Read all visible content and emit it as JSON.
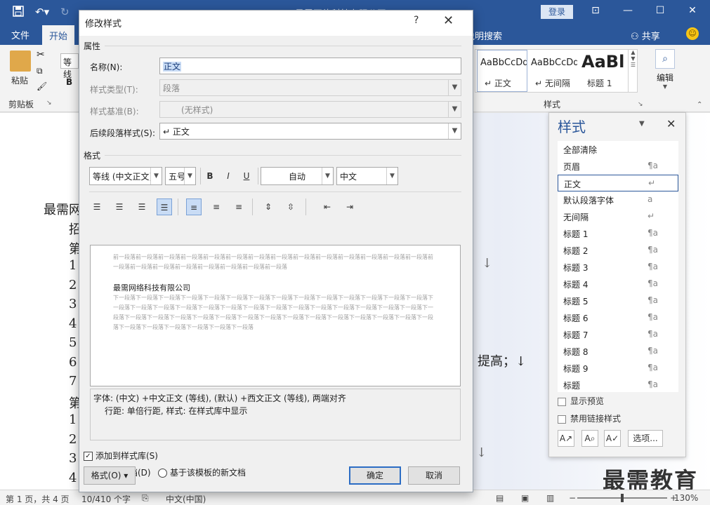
{
  "window": {
    "title": "最需网络科技有限公司1... - Word",
    "login": "登录",
    "tabs": [
      "文件",
      "开始"
    ],
    "tell_me": "告诉我您想要做什么说明搜索",
    "tell_me_visible": "作说明搜索",
    "share": "共享"
  },
  "ribbon": {
    "paste_label": "粘贴",
    "clipboard_label": "剪贴板",
    "font_name_stub": "等线",
    "bold": "B",
    "styles_group_label": "样式",
    "gallery": [
      {
        "sample": "AaBbCcDd",
        "name": "↵ 正文"
      },
      {
        "sample": "AaBbCcDd",
        "name": "↵ 无间隔"
      },
      {
        "sample": "AaBl",
        "name": "标题 1"
      }
    ],
    "edit_label": "编辑"
  },
  "document": {
    "line1": "最需网",
    "col_chars": [
      "招",
      "第",
      "1",
      "2",
      "3",
      "4",
      "5",
      "6",
      "7",
      "第",
      "1",
      "2",
      "3",
      "4"
    ],
    "right_frag_1": "↓",
    "right_frag_2": "提高；↓",
    "right_frag_3": "↓"
  },
  "status": {
    "page": "第 1 页，共 4 页",
    "words": "10/410 个字",
    "lang": "中文(中国)",
    "zoom": "130%"
  },
  "styles_pane": {
    "title": "样式",
    "items": [
      {
        "name": "全部清除",
        "mark": ""
      },
      {
        "name": "页眉",
        "mark": "¶a"
      },
      {
        "name": "正文",
        "mark": "↵"
      },
      {
        "name": "默认段落字体",
        "mark": "a"
      },
      {
        "name": "无间隔",
        "mark": "↵"
      },
      {
        "name": "标题 1",
        "mark": "¶a"
      },
      {
        "name": "标题 2",
        "mark": "¶a"
      },
      {
        "name": "标题 3",
        "mark": "¶a"
      },
      {
        "name": "标题 4",
        "mark": "¶a"
      },
      {
        "name": "标题 5",
        "mark": "¶a"
      },
      {
        "name": "标题 6",
        "mark": "¶a"
      },
      {
        "name": "标题 7",
        "mark": "¶a"
      },
      {
        "name": "标题 8",
        "mark": "¶a"
      },
      {
        "name": "标题 9",
        "mark": "¶a"
      },
      {
        "name": "标题",
        "mark": "¶a"
      }
    ],
    "selected_index": 2,
    "show_preview": "显示预览",
    "disable_linked": "禁用链接样式",
    "options": "选项..."
  },
  "watermark": "最需教育",
  "dialog": {
    "title": "修改样式",
    "help": "?",
    "section_props": "属性",
    "name_label": "名称(N):",
    "name_value": "正文",
    "type_label": "样式类型(T):",
    "type_value": "段落",
    "based_label": "样式基准(B):",
    "based_value": "(无样式)",
    "next_label": "后续段落样式(S):",
    "next_value": "↵ 正文",
    "section_format": "格式",
    "font_value": "等线 (中文正文)",
    "size_value": "五号",
    "bold": "B",
    "italic": "I",
    "underline": "U",
    "color_value": "自动",
    "script_value": "中文",
    "preview_prev": "前一段落前一段落前一段落前一段落前一段落前一段落前一段落前一段落前一段落前一段落前一段落前一段落前一段落前一段落前一段落前一段落前一段落前一段落前一段落前一段落前一段落前一段落",
    "preview_main": "最需网络科技有限公司",
    "preview_next": "下一段落下一段落下一段落下一段落下一段落下一段落下一段落下一段落下一段落下一段落下一段落下一段落下一段落下一段落下一段落下一段落下一段落下一段落下一段落下一段落下一段落下一段落下一段落下一段落下一段落下一段落下一段落下一段落下一段落下一段落下一段落下一段落下一段落下一段落下一段落下一段落下一段落下一段落下一段落下一段落下一段落下一段落下一段落下一段落下一段落下一段落下一段落下一段落下一段落",
    "desc_line1": "字体: (中文) +中文正文 (等线), (默认) +西文正文 (等线), 两端对齐",
    "desc_line2": "行距: 单倍行距, 样式: 在样式库中显示",
    "add_gallery": "添加到样式库(S)",
    "only_doc": "仅限此文档(D)",
    "template_doc": "基于该模板的新文档",
    "format_btn": "格式(O) ▾",
    "ok": "确定",
    "cancel": "取消"
  }
}
